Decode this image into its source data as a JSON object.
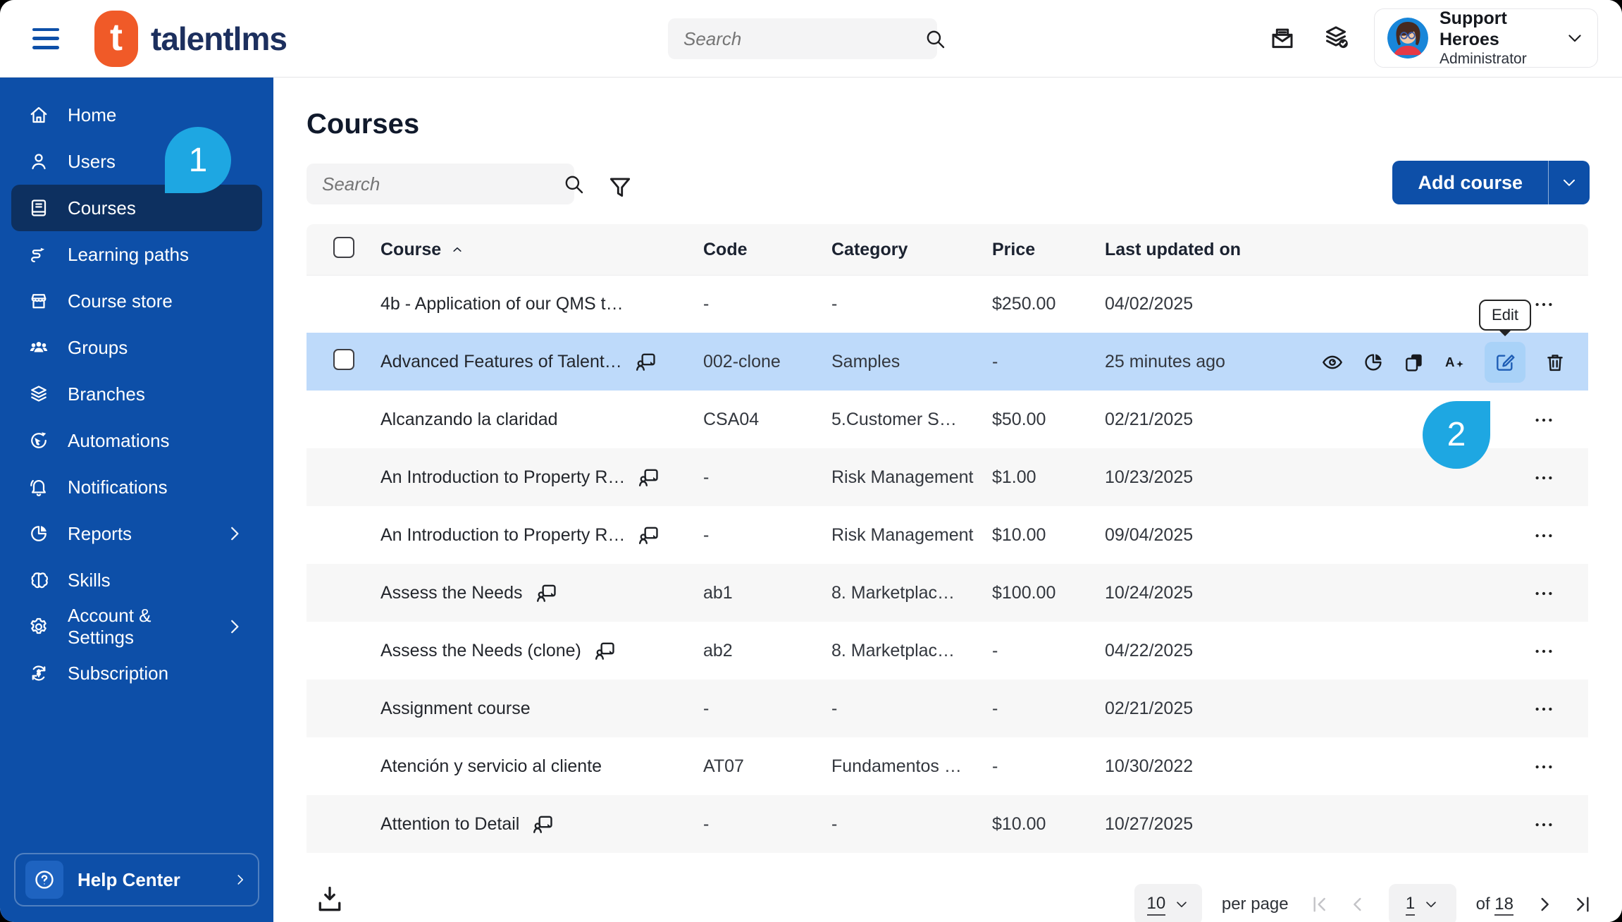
{
  "header": {
    "brand": "talentlms",
    "brand_initial": "t",
    "search_placeholder": "Search",
    "user": {
      "name": "Support Heroes",
      "role": "Administrator"
    }
  },
  "sidebar": {
    "items": [
      {
        "label": "Home",
        "icon": "home-icon"
      },
      {
        "label": "Users",
        "icon": "user-icon"
      },
      {
        "label": "Courses",
        "icon": "book-icon",
        "active": true
      },
      {
        "label": "Learning paths",
        "icon": "path-icon"
      },
      {
        "label": "Course store",
        "icon": "store-icon"
      },
      {
        "label": "Groups",
        "icon": "groups-icon"
      },
      {
        "label": "Branches",
        "icon": "layers-icon"
      },
      {
        "label": "Automations",
        "icon": "automation-icon"
      },
      {
        "label": "Notifications",
        "icon": "bell-icon"
      },
      {
        "label": "Reports",
        "icon": "pie-icon",
        "chevron": true
      },
      {
        "label": "Skills",
        "icon": "brain-icon"
      },
      {
        "label": "Account & Settings",
        "icon": "gear-icon",
        "chevron": true
      },
      {
        "label": "Subscription",
        "icon": "subscription-icon"
      }
    ],
    "help": {
      "label": "Help Center",
      "icon": "question-icon"
    }
  },
  "page": {
    "title": "Courses",
    "search_placeholder": "Search",
    "add_button": "Add course"
  },
  "table": {
    "columns": [
      "Course",
      "Code",
      "Category",
      "Price",
      "Last updated on"
    ],
    "rows": [
      {
        "title": "4b - Application of our QMS t…",
        "type_icon": false,
        "code": "-",
        "category": "-",
        "price": "$250.00",
        "updated": "04/02/2025"
      },
      {
        "title": "Advanced Features of Talent…",
        "type_icon": true,
        "code": "002-clone",
        "category": "Samples",
        "price": "-",
        "updated": "25 minutes ago",
        "highlighted": true
      },
      {
        "title": "Alcanzando la claridad",
        "type_icon": false,
        "code": "CSA04",
        "category": "5.Customer S…",
        "price": "$50.00",
        "updated": "02/21/2025"
      },
      {
        "title": "An Introduction to Property R…",
        "type_icon": true,
        "code": "-",
        "category": "Risk Management",
        "price": "$1.00",
        "updated": "10/23/2025"
      },
      {
        "title": "An Introduction to Property R…",
        "type_icon": true,
        "code": "-",
        "category": "Risk Management",
        "price": "$10.00",
        "updated": "09/04/2025"
      },
      {
        "title": "Assess the Needs",
        "type_icon": true,
        "code": "ab1",
        "category": "8. Marketplac…",
        "price": "$100.00",
        "updated": "10/24/2025"
      },
      {
        "title": "Assess the Needs (clone)",
        "type_icon": true,
        "code": "ab2",
        "category": "8. Marketplac…",
        "price": "-",
        "updated": "04/22/2025"
      },
      {
        "title": "Assignment course",
        "type_icon": false,
        "code": "-",
        "category": "-",
        "price": "-",
        "updated": "02/21/2025"
      },
      {
        "title": "Atención y servicio al cliente",
        "type_icon": false,
        "code": "AT07",
        "category": "Fundamentos …",
        "price": "-",
        "updated": "10/30/2022"
      },
      {
        "title": "Attention to Detail",
        "type_icon": true,
        "code": "-",
        "category": "-",
        "price": "$10.00",
        "updated": "10/27/2025"
      }
    ]
  },
  "row_actions": {
    "tooltip": "Edit",
    "icons": [
      {
        "name": "eye-icon"
      },
      {
        "name": "pie-chart-icon"
      },
      {
        "name": "copy-icon"
      },
      {
        "name": "translate-icon"
      },
      {
        "name": "edit-icon",
        "active": true
      },
      {
        "name": "trash-icon"
      }
    ]
  },
  "pagination": {
    "per_page_value": "10",
    "per_page_label": "per page",
    "page_value": "1",
    "of_label": "of",
    "total_pages": "18"
  },
  "callouts": {
    "step1": "1",
    "step2": "2"
  },
  "colors": {
    "sidebar": "#0d4fa8",
    "active_item": "#0d3060",
    "accent_callout": "#1ea7e2",
    "highlight_row": "#bedafa",
    "brand_orange": "#f05a28",
    "primary_button": "#0d4fa8"
  }
}
